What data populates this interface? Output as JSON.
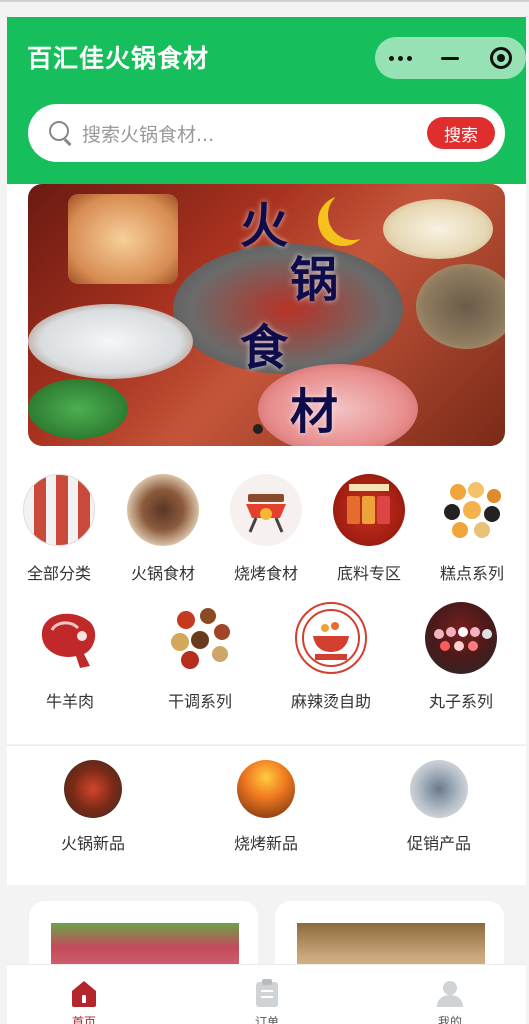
{
  "header": {
    "title": "百汇佳火锅食材",
    "capsule": {
      "more_icon": "more-dots-icon",
      "minimize_icon": "minimize-icon",
      "close_icon": "close-target-icon"
    },
    "bg_color": "#17bf5c"
  },
  "search": {
    "placeholder": "搜索火锅食材...",
    "button_label": "搜索",
    "button_color": "#e02e2e"
  },
  "banner": {
    "chars": [
      "火",
      "锅",
      "食",
      "材"
    ],
    "active_dot": 1
  },
  "categories": [
    {
      "label": "全部分类",
      "icon": "all-categories-icon"
    },
    {
      "label": "火锅食材",
      "icon": "hotpot-ingredients-icon"
    },
    {
      "label": "烧烤食材",
      "icon": "bbq-grill-icon"
    },
    {
      "label": "底料专区",
      "icon": "soup-base-icon"
    },
    {
      "label": "糕点系列",
      "icon": "pastry-icon"
    },
    {
      "label": "牛羊肉",
      "icon": "beef-steak-icon"
    },
    {
      "label": "干调系列",
      "icon": "dried-spices-icon"
    },
    {
      "label": "麻辣烫自助",
      "icon": "malatang-icon"
    },
    {
      "label": "丸子系列",
      "icon": "meatballs-icon"
    }
  ],
  "new_items": [
    {
      "label": "火锅新品",
      "icon": "hotpot-new-icon"
    },
    {
      "label": "烧烤新品",
      "icon": "bbq-new-icon"
    },
    {
      "label": "促销产品",
      "icon": "promo-shrimp-icon"
    }
  ],
  "tabbar": [
    {
      "label": "首页",
      "icon": "home-icon",
      "active": true
    },
    {
      "label": "订单",
      "icon": "order-clipboard-icon",
      "active": false
    },
    {
      "label": "我的",
      "icon": "profile-icon",
      "active": false
    }
  ]
}
